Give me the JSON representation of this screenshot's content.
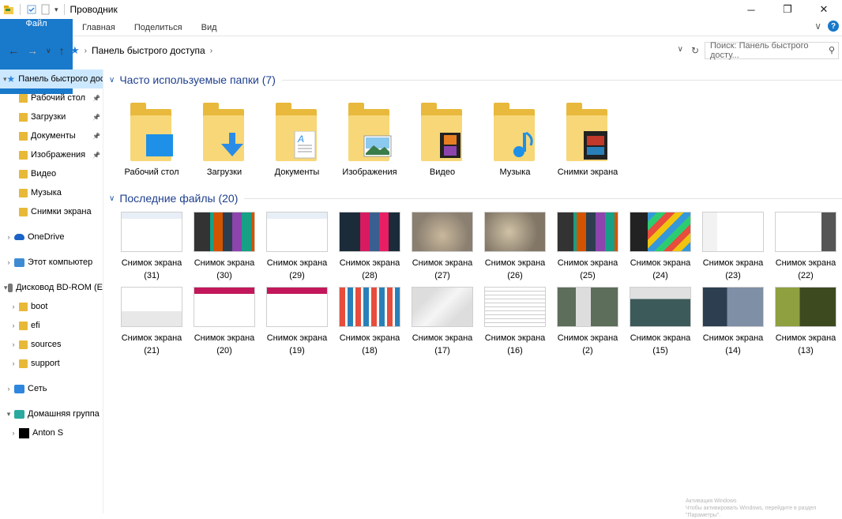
{
  "window": {
    "title": "Проводник",
    "controls": [
      "minimize",
      "maximize",
      "close"
    ]
  },
  "ribbon": {
    "tabs": [
      "Файл",
      "Главная",
      "Поделиться",
      "Вид"
    ],
    "active": "Файл"
  },
  "address": {
    "path": "Панель быстрого доступа",
    "search_placeholder": "Поиск: Панель быстрого досту..."
  },
  "sidebar": {
    "items": [
      {
        "label": "Панель быстрого доступа",
        "level": 0,
        "icon": "star-icon",
        "arrow": "expanded",
        "selected": true
      },
      {
        "label": "Рабочий стол",
        "level": 1,
        "icon": "desktop-icon",
        "pinned": true
      },
      {
        "label": "Загрузки",
        "level": 1,
        "icon": "download-icon",
        "pinned": true
      },
      {
        "label": "Документы",
        "level": 1,
        "icon": "documents-icon",
        "pinned": true
      },
      {
        "label": "Изображения",
        "level": 1,
        "icon": "pictures-icon",
        "pinned": true
      },
      {
        "label": "Видео",
        "level": 1,
        "icon": "video-icon"
      },
      {
        "label": "Музыка",
        "level": 1,
        "icon": "music-icon"
      },
      {
        "label": "Снимки экрана",
        "level": 1,
        "icon": "folder-icon"
      },
      {
        "label": "OneDrive",
        "level": 0,
        "icon": "onedrive-icon",
        "arrow": "collapsed",
        "gap": true
      },
      {
        "label": "Этот компьютер",
        "level": 0,
        "icon": "computer-icon",
        "arrow": "collapsed",
        "gap": true
      },
      {
        "label": "Дисковод BD-ROM (E",
        "level": 0,
        "icon": "disc-icon",
        "arrow": "expanded",
        "gap": true
      },
      {
        "label": "boot",
        "level": 1,
        "icon": "folder-icon",
        "arrow": "collapsed"
      },
      {
        "label": "efi",
        "level": 1,
        "icon": "folder-icon",
        "arrow": "collapsed"
      },
      {
        "label": "sources",
        "level": 1,
        "icon": "folder-icon",
        "arrow": "collapsed"
      },
      {
        "label": "support",
        "level": 1,
        "icon": "folder-icon",
        "arrow": "collapsed"
      },
      {
        "label": "Сеть",
        "level": 0,
        "icon": "network-icon",
        "arrow": "collapsed",
        "gap": true
      },
      {
        "label": "Домашняя группа",
        "level": 0,
        "icon": "homegroup-icon",
        "arrow": "expanded",
        "gap": true
      },
      {
        "label": "Anton S",
        "level": 1,
        "icon": "user-icon",
        "arrow": "collapsed"
      }
    ]
  },
  "frequent": {
    "title": "Часто используемые папки (7)",
    "folders": [
      {
        "label": "Рабочий стол",
        "overlay": "desktop"
      },
      {
        "label": "Загрузки",
        "overlay": "download"
      },
      {
        "label": "Документы",
        "overlay": "document"
      },
      {
        "label": "Изображения",
        "overlay": "picture"
      },
      {
        "label": "Видео",
        "overlay": "video"
      },
      {
        "label": "Музыка",
        "overlay": "music"
      },
      {
        "label": "Снимки экрана",
        "overlay": "screens"
      }
    ]
  },
  "recent": {
    "title": "Последние файлы (20)",
    "files": [
      {
        "name": "Снимок экрана",
        "num": "(31)",
        "style": "light"
      },
      {
        "name": "Снимок экрана",
        "num": "(30)",
        "style": "dark"
      },
      {
        "name": "Снимок экрана",
        "num": "(29)",
        "style": "light"
      },
      {
        "name": "Снимок экрана",
        "num": "(28)",
        "style": "metro"
      },
      {
        "name": "Снимок экрана",
        "num": "(27)",
        "style": "city"
      },
      {
        "name": "Снимок экрана",
        "num": "(26)",
        "style": "city2"
      },
      {
        "name": "Снимок экрана",
        "num": "(25)",
        "style": "dark"
      },
      {
        "name": "Снимок экрана",
        "num": "(24)",
        "style": "colorful"
      },
      {
        "name": "Снимок экрана",
        "num": "(23)",
        "style": "settings"
      },
      {
        "name": "Снимок экрана",
        "num": "(22)",
        "style": "settings2"
      },
      {
        "name": "Снимок экрана",
        "num": "(21)",
        "style": "dialog"
      },
      {
        "name": "Снимок экрана",
        "num": "(20)",
        "style": "web"
      },
      {
        "name": "Снимок экрана",
        "num": "(19)",
        "style": "web"
      },
      {
        "name": "Снимок экрана",
        "num": "(18)",
        "style": "tiles"
      },
      {
        "name": "Снимок экрана",
        "num": "(17)",
        "style": "sketch"
      },
      {
        "name": "Снимок экрана",
        "num": "(16)",
        "style": "doc"
      },
      {
        "name": "Снимок экрана",
        "num": "(2)",
        "style": "desk"
      },
      {
        "name": "Снимок экрана",
        "num": "(15)",
        "style": "desk2"
      },
      {
        "name": "Снимок экрана",
        "num": "(14)",
        "style": "desk3"
      },
      {
        "name": "Снимок экрана",
        "num": "(13)",
        "style": "desk4"
      }
    ]
  },
  "watermark": {
    "line1": "Активация Windows",
    "line2": "Чтобы активировать Windows, перейдите в раздел \"Параметры\"."
  }
}
